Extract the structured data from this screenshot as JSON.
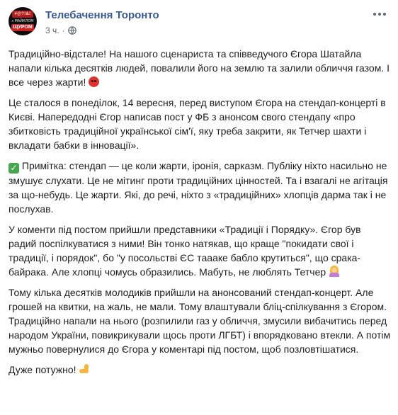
{
  "post": {
    "page_name": "Телебачення Торонто",
    "time": "3 ч.",
    "avatar_text": [
      "#@?!&!",
      "з МАЙКЛОМ",
      "ЩУРОМ"
    ],
    "paragraphs": [
      "Традиційно-відстале! На нашого сценариста та співведучого Єгора Шатайла напали кілька десятків людей, повалили його на землю та залили обличчя газом. І все через жарти!",
      "Це сталося в понеділок, 14 вересня, перед виступом Єгора на стендап-концерті в Києві. Напередодні Єгор написав пост у ФБ з анонсом свого стендапу «про збитковість традиційної української сім'ї, яку треба закрити, як Тетчер шахти і вкладати бабки в інновації».",
      "Примітка: стендап — це коли жарти, іронія, сарказм. Публіку ніхто насильно не змушує слухати. Це не мітинг проти традиційних цінностей. Та і взагалі не агітація за що-небудь. Це жарти. Які, до речі, ніхто з «традиційних» хлопців дарма так і не послухав.",
      "У коменти під постом прийшли представники «Традиції і Порядку». Єгор був радий поспілкуватися з ними! Він тонко натякав, що краще \"покидати свої і традиції, і порядок\", бо \"у посольстві ЄС тaaaкe бабло крутиться\", що срака-байрака. Але хлопці чомусь образились. Мабуть, не люблять Тетчер",
      "Тому кілька десятків молодиків прийшли на анонсований стендап-концерт. Але грошей на квитки, на жаль, не мали. Тому влаштували бліц-спілкування з Єгором. Традиційно напали на нього (розпилили газ у обличчя, змусили вибачитись перед народом України, повикрикували щось проти ЛГБТ) і впорядковано втекли. А потім мужньо повернулися до Єгора у коментарі під постом, щоб позловтішатися.",
      "Дуже потужно!"
    ]
  },
  "icons": {
    "privacy": "globe-icon",
    "options": "more-options-icon",
    "emoji_1": "angry-face-icon",
    "emoji_2": "check-mark-icon",
    "emoji_3": "woman-gesturing-no-icon",
    "emoji_4": "flexed-biceps-icon"
  },
  "colors": {
    "page_name": "#385898",
    "text": "#1c1e21",
    "meta": "#606770"
  }
}
